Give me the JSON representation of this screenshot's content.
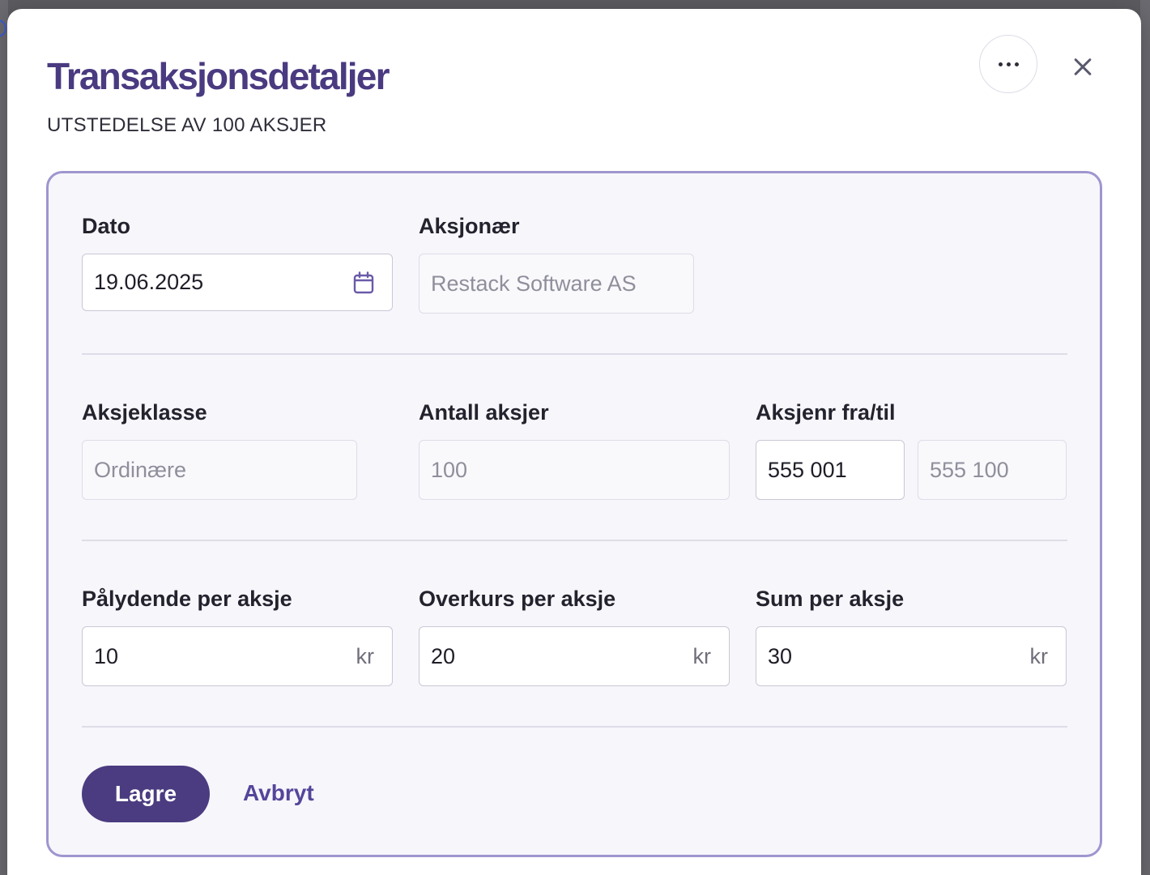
{
  "dialog": {
    "title": "Transaksjonsdetaljer",
    "subtitle": "UTSTEDELSE AV 100 AKSJER",
    "more_icon": "more-horizontal-icon",
    "close_icon": "close-icon"
  },
  "form": {
    "date": {
      "label": "Dato",
      "value": "19.06.2025",
      "icon": "calendar-icon"
    },
    "shareholder": {
      "label": "Aksjonær",
      "value": "Restack Software AS"
    },
    "share_class": {
      "label": "Aksjeklasse",
      "value": "Ordinære"
    },
    "share_count": {
      "label": "Antall aksjer",
      "value": "100"
    },
    "share_numbers": {
      "label": "Aksjenr fra/til",
      "from": "555 001",
      "to": "555 100"
    },
    "nominal": {
      "label": "Pålydende per aksje",
      "value": "10",
      "suffix": "kr"
    },
    "premium": {
      "label": "Overkurs per aksje",
      "value": "20",
      "suffix": "kr"
    },
    "sum": {
      "label": "Sum per aksje",
      "value": "30",
      "suffix": "kr"
    }
  },
  "actions": {
    "save_label": "Lagre",
    "cancel_label": "Avbryt"
  },
  "colors": {
    "accent": "#4b3b80",
    "title": "#4a3a80",
    "card_border": "#9e96cf"
  }
}
